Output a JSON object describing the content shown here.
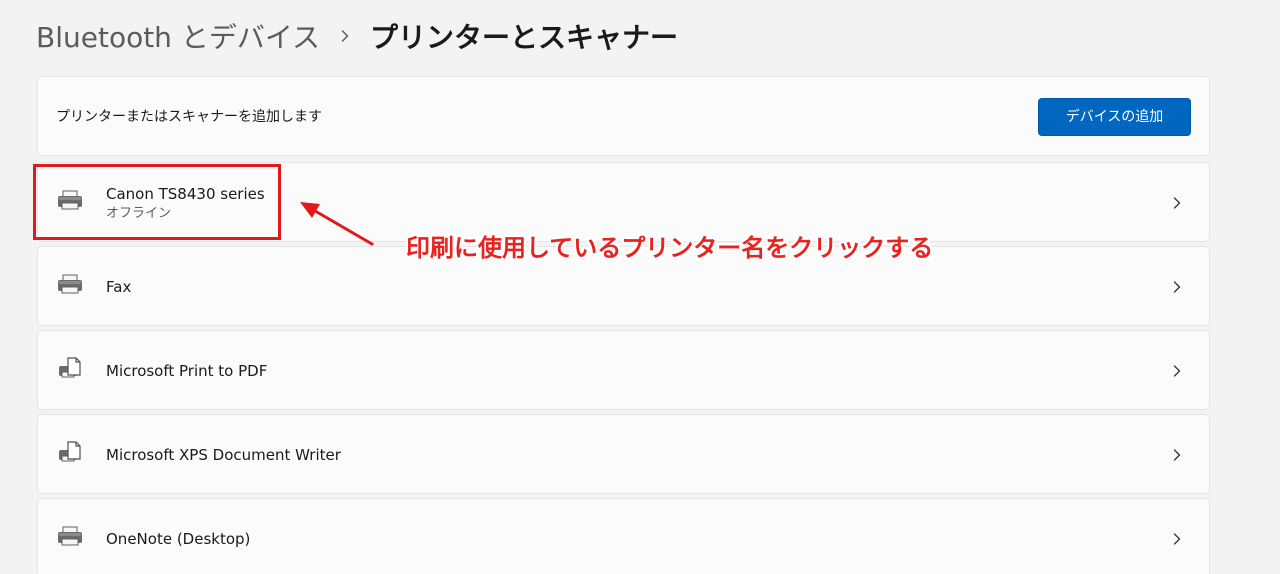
{
  "breadcrumb": {
    "parent": "Bluetooth とデバイス",
    "separator_icon": "chevron-right-icon",
    "current": "プリンターとスキャナー"
  },
  "add_device": {
    "label": "プリンターまたはスキャナーを追加します",
    "button_label": "デバイスの追加"
  },
  "devices": [
    {
      "name": "Canon TS8430 series",
      "status": "オフライン",
      "icon": "printer-icon"
    },
    {
      "name": "Fax",
      "status": "",
      "icon": "printer-icon"
    },
    {
      "name": "Microsoft Print to PDF",
      "status": "",
      "icon": "printer-document-icon"
    },
    {
      "name": "Microsoft XPS Document Writer",
      "status": "",
      "icon": "printer-document-icon"
    },
    {
      "name": "OneNote (Desktop)",
      "status": "",
      "icon": "printer-icon"
    }
  ],
  "annotation": {
    "text": "印刷に使用しているプリンター名をクリックする",
    "color": "#e0191b"
  },
  "colors": {
    "accent": "#0067c0",
    "background": "#f3f3f3",
    "card": "#fbfbfb"
  }
}
